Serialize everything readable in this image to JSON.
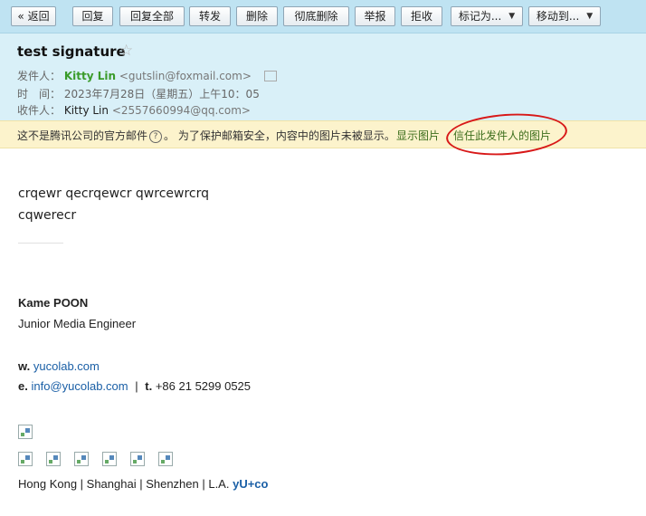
{
  "toolbar": {
    "back": "« 返回",
    "reply": "回复",
    "reply_all": "回复全部",
    "forward": "转发",
    "delete": "删除",
    "delete_permanently": "彻底删除",
    "report": "举报",
    "reject": "拒收",
    "mark_as": "标记为...",
    "move_to": "移动到..."
  },
  "email": {
    "subject": "test signature",
    "star": "☆",
    "from_label": "发件人：",
    "from_name": "Kitty Lin",
    "from_addr": "<gutslin@foxmail.com>",
    "time_label": "时　间：",
    "time_value": "2023年7月28日（星期五）上午10：05",
    "to_label": "收件人：",
    "to_name": "Kitty Lin",
    "to_addr": "<2557660994@qq.com>"
  },
  "warning": {
    "text_a": "这不是腾讯公司的官方邮件",
    "help": "?",
    "text_b": "。 为了保护邮箱安全，内容中的图片未被显示。",
    "show_images": "显示图片",
    "trust_sender": "信任此发件人的图片"
  },
  "body": {
    "line1": "crqewr qecrqewcr qwrcewrcrq",
    "line2": "cqwerecr"
  },
  "signature": {
    "name": "Kame POON",
    "title": "Junior Media Engineer",
    "w_label": "w.",
    "website": "yucolab.com",
    "e_label": "e.",
    "email": "info@yucolab.com",
    "pipe": "|",
    "t_label": "t.",
    "phone": "+86 21 5299 0525",
    "cities": "Hong Kong | Shanghai | Shenzhen | L.A.",
    "brand": "yU+co"
  },
  "colors": {
    "toolbar_bg": "#bfe3f2",
    "header_bg": "#d9f0f8",
    "warning_bg": "#fcf3cc",
    "sender_green": "#3a9b2a",
    "link_blue": "#1a5fa6",
    "annotation_red": "#d81818"
  }
}
